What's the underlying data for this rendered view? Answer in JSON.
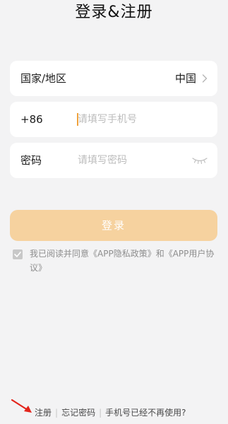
{
  "header": {
    "title": "登录&注册"
  },
  "region_field": {
    "label": "国家/地区",
    "value": "中国"
  },
  "phone_field": {
    "prefix": "+86",
    "placeholder": "请填写手机号"
  },
  "password_field": {
    "label": "密码",
    "placeholder": "请填写密码"
  },
  "login_button": {
    "label": "登录"
  },
  "agreement": {
    "checked": false,
    "prefix": "我已阅读并同意",
    "privacy_link": "《APP隐私政策》",
    "and": "和",
    "user_agreement_link": "《APP用户协议》"
  },
  "footer": {
    "register": "注册",
    "forgot_password": "忘记密码",
    "phone_unavailable": "手机号已经不再使用?"
  },
  "colors": {
    "background": "#f3f3f4",
    "login_button": "#f6d29f",
    "cursor": "#f0a23c",
    "annotation_arrow": "#e3241b"
  },
  "icons": {
    "region_chevron": "chevron-right-icon",
    "password_visibility": "eye-closed-icon",
    "agreement_check": "check-icon"
  }
}
